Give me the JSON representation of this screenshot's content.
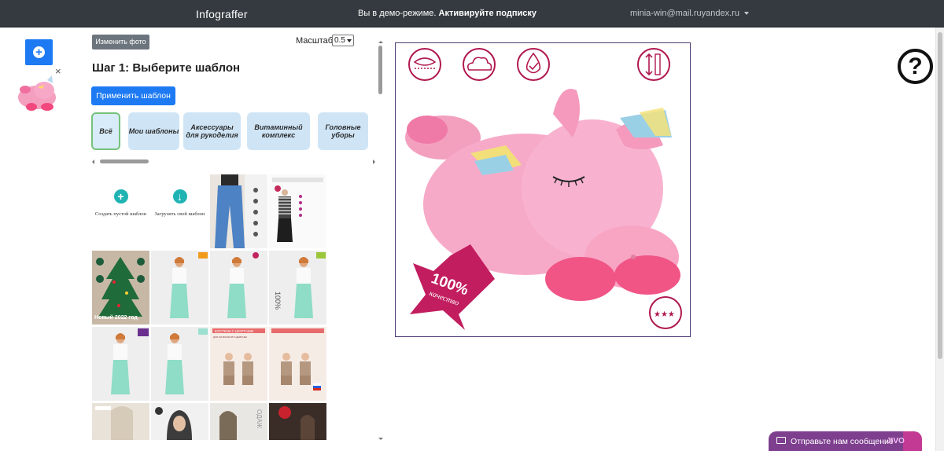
{
  "navbar": {
    "brand": "Infograffer",
    "demo_text": "Вы в демо-режиме.",
    "demo_link": "Активируйте подписку",
    "user_email": "minia-win@mail.ruyandex.ru"
  },
  "left_panel": {
    "add_button_icon": "plus-circle-icon",
    "close_icon": "×"
  },
  "editor": {
    "change_photo_label": "Изменить фото",
    "scale_label": "Масштаб:",
    "scale_value": "0.5",
    "step_title": "Шаг 1: Выберите шаблон",
    "apply_button_label": "Применить шаблон",
    "categories": [
      {
        "label": "Всё",
        "active": true
      },
      {
        "label": "Мои шаблоны",
        "active": false
      },
      {
        "label": "Аксессуары для рукоделия",
        "active": false
      },
      {
        "label": "Витаминный комплекс",
        "active": false
      },
      {
        "label": "Головные уборы",
        "active": false
      }
    ],
    "template_actions": {
      "create_empty": "Создать пустой шаблон",
      "upload_own": "Загрузить свой шаблон"
    },
    "template_captions": {
      "new_year": "Новый 2022 год",
      "percent_text": "100%",
      "kids_header": "КОСТЮМ С ШОРТАМИ",
      "kids_sub": "ДЛЯ МАЛЬЧИКОВ И ДЕВОЧЕК",
      "bottom_badge": "ОДАЖ"
    }
  },
  "preview": {
    "badge_top": "100%",
    "badge_bottom": "качество",
    "stars": "★★★"
  },
  "help_icon_symbol": "?",
  "chat": {
    "label": "Отправьте нам сообщение",
    "brand": "JIVO"
  },
  "colors": {
    "navbar": "#343a40",
    "primary": "#1d7af3",
    "secondary": "#6c757d",
    "category_bg": "#cfe5f6",
    "badge": "#c21d5f",
    "chat": "#7e3f8f"
  }
}
